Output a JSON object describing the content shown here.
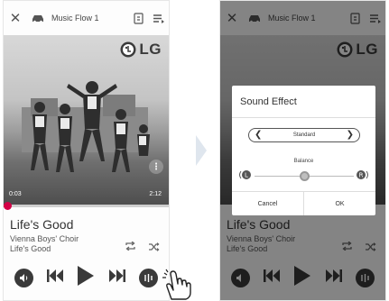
{
  "colors": {
    "accent": "#d40046",
    "panel": "#fdfdfd",
    "dim": "rgba(0,0,0,0.48)"
  },
  "player": {
    "close_icon": "close-icon",
    "device_icon": "car-icon",
    "title": "Music Flow 1",
    "logo_text": "LG",
    "elapsed": "0:03",
    "duration": "2:12",
    "progress": 0.02,
    "song": "Life's Good",
    "artist": "Vienna Boys' Choir",
    "album": "Life's Good"
  },
  "dialog": {
    "title": "Sound Effect",
    "mode": "Standard",
    "balance_label": "Balance",
    "balance_value": 0.5,
    "cancel_label": "Cancel",
    "ok_label": "OK"
  }
}
